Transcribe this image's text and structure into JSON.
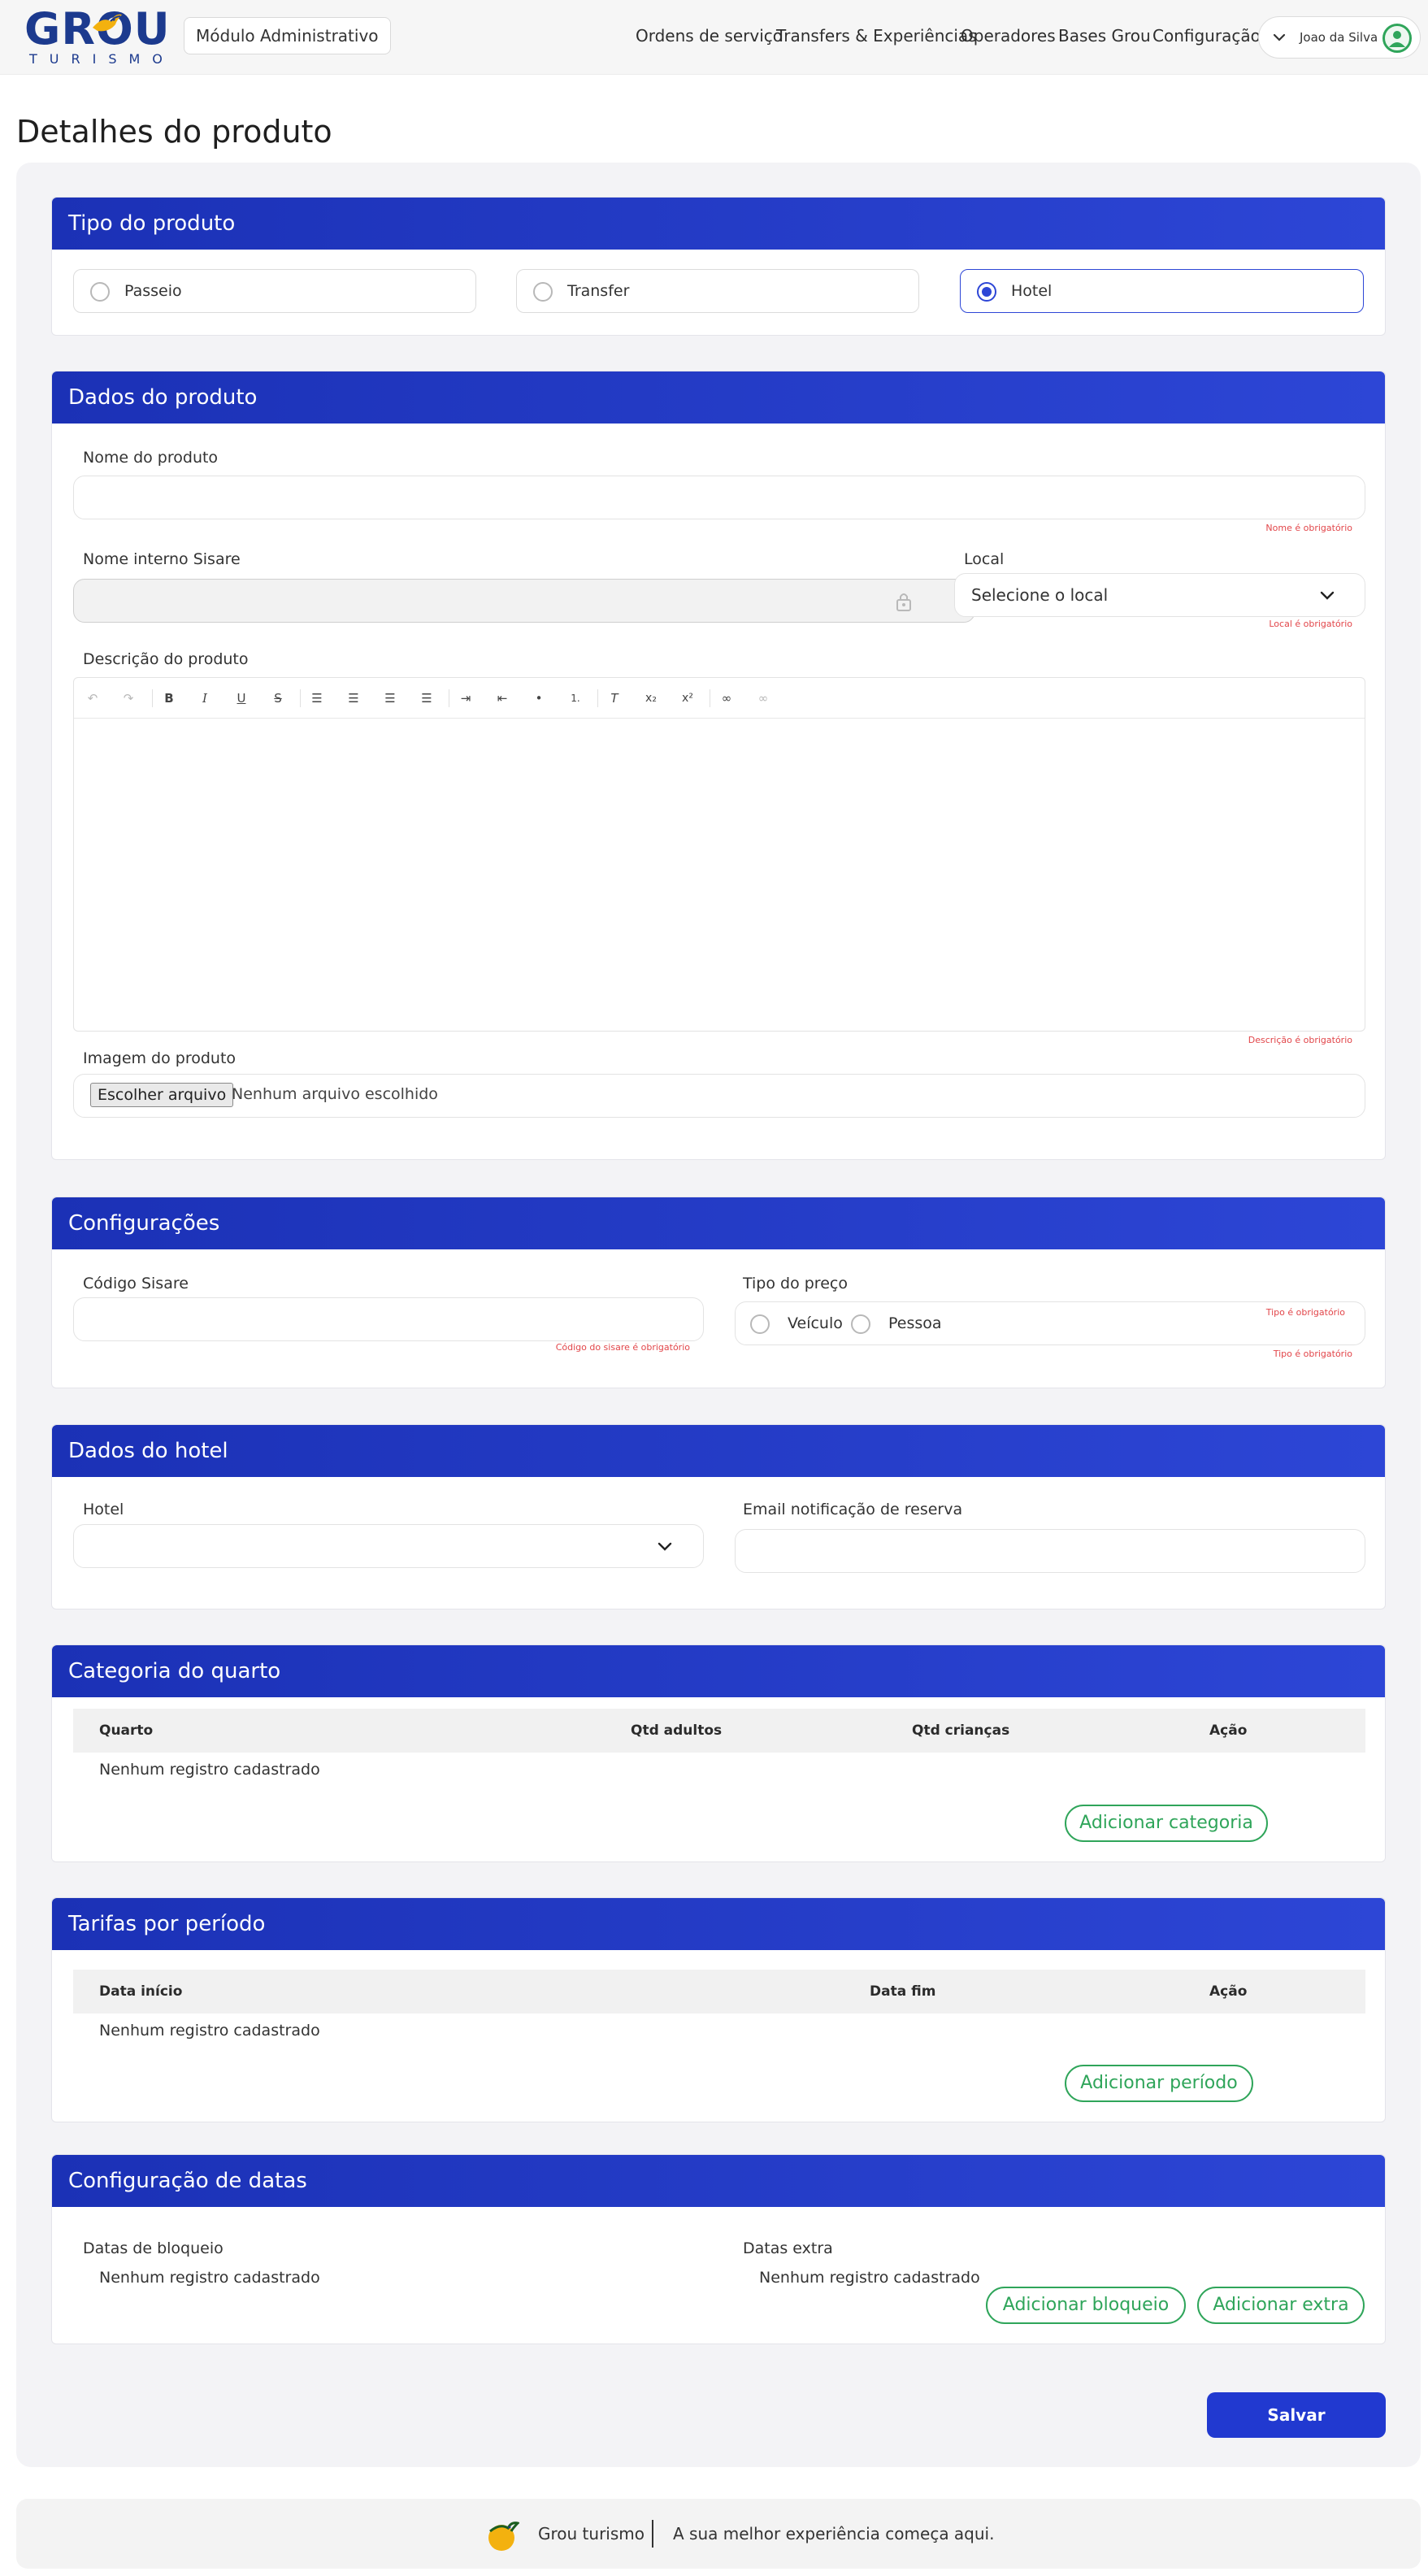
{
  "header": {
    "logo_word": "GROU",
    "logo_sub": "TURISMO",
    "module_label": "Módulo Administrativo",
    "nav": [
      "Ordens de serviço",
      "Transfers & Experiências",
      "Operadores",
      "Bases Grou",
      "Configuração"
    ],
    "user_name": "Joao da Silva"
  },
  "page": {
    "title": "Detalhes do produto"
  },
  "tipo_produto": {
    "title": "Tipo do produto",
    "options": [
      "Passeio",
      "Transfer",
      "Hotel"
    ],
    "selected": "Hotel"
  },
  "dados_produto": {
    "title": "Dados do produto",
    "nome_label": "Nome do produto",
    "nome_value": "",
    "nome_error": "Nome é obrigatório",
    "nome_interno_label": "Nome interno Sisare",
    "local_label": "Local",
    "local_placeholder": "Selecione o local",
    "local_error": "Local é obrigatório",
    "descricao_label": "Descrição do produto",
    "descricao_error": "Descrição é obrigatório",
    "imagem_label": "Imagem do produto",
    "file_button": "Escolher arquivo",
    "file_status": "Nenhum arquivo escolhido"
  },
  "configuracoes": {
    "title": "Configurações",
    "codigo_label": "Código Sisare",
    "codigo_error": "Código do sisare é obrigatório",
    "tipo_preco_label": "Tipo do preço",
    "tipo_preco_options": [
      "Veículo",
      "Pessoa"
    ],
    "tipo_error_top": "Tipo é obrigatório",
    "tipo_error_bottom": "Tipo é obrigatório"
  },
  "dados_hotel": {
    "title": "Dados do hotel",
    "hotel_label": "Hotel",
    "email_label": "Email notificação de reserva"
  },
  "categoria_quarto": {
    "title": "Categoria do quarto",
    "columns": [
      "Quarto",
      "Qtd adultos",
      "Qtd crianças",
      "Ação"
    ],
    "empty": "Nenhum registro cadastrado",
    "add_button": "Adicionar categoria"
  },
  "tarifas": {
    "title": "Tarifas por período",
    "columns": [
      "Data início",
      "Data fim",
      "Ação"
    ],
    "empty": "Nenhum registro cadastrado",
    "add_button": "Adicionar período"
  },
  "config_datas": {
    "title": "Configuração de datas",
    "bloqueio_label": "Datas de bloqueio",
    "bloqueio_empty": "Nenhum registro cadastrado",
    "extra_label": "Datas extra",
    "extra_empty": "Nenhum registro cadastrado",
    "add_bloqueio": "Adicionar bloqueio",
    "add_extra": "Adicionar extra"
  },
  "actions": {
    "save": "Salvar"
  },
  "footer": {
    "brand": "Grou turismo",
    "tagline": "A sua melhor experiência começa aqui."
  },
  "colors": {
    "primary": "#2139d0",
    "success": "#2fa55a",
    "error": "#e2464a"
  }
}
